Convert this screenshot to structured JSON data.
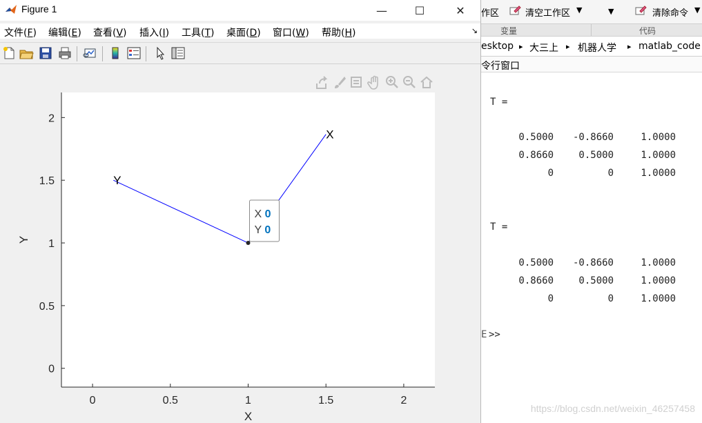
{
  "figure": {
    "title": "Figure 1",
    "window_controls": {
      "minimize": "—",
      "maximize": "☐",
      "close": "✕"
    },
    "menu": [
      {
        "label": "文件(",
        "key": "F",
        "end": ")"
      },
      {
        "label": "编辑(",
        "key": "E",
        "end": ")"
      },
      {
        "label": "查看(",
        "key": "V",
        "end": ")"
      },
      {
        "label": "插入(",
        "key": "I",
        "end": ")"
      },
      {
        "label": "工具(",
        "key": "T",
        "end": ")"
      },
      {
        "label": "桌面(",
        "key": "D",
        "end": ")"
      },
      {
        "label": "窗口(",
        "key": "W",
        "end": ")"
      },
      {
        "label": "帮助(",
        "key": "H",
        "end": ")"
      }
    ],
    "dock_arrow": "↘",
    "toolbar_icons": [
      "new-figure-icon",
      "open-file-icon",
      "save-icon",
      "print-icon",
      "link-plot-icon",
      "colorbar-icon",
      "legend-icon",
      "pointer-icon",
      "property-inspector-icon"
    ],
    "axes_toolbar_icons": [
      "export-icon",
      "brush-icon",
      "datatip-icon",
      "pan-icon",
      "zoom-in-icon",
      "zoom-out-icon",
      "home-icon"
    ],
    "colors": {
      "line": "#0000ff",
      "axes_bg": "#f0f0f0",
      "plot_bg": "#ffffff",
      "datatip_value": "#0072bd"
    }
  },
  "chart_data": {
    "type": "line",
    "xlabel": "X",
    "ylabel": "Y",
    "xlim": [
      -0.2,
      2.2
    ],
    "ylim": [
      -0.15,
      2.2
    ],
    "xticks": [
      0,
      0.5,
      1,
      1.5,
      2
    ],
    "xtick_labels": [
      "0",
      "0.5",
      "1",
      "1.5",
      "2"
    ],
    "yticks": [
      0,
      0.5,
      1,
      1.5,
      2
    ],
    "ytick_labels": [
      "0",
      "0.5",
      "1",
      "1.5",
      "2"
    ],
    "grid": false,
    "series": [
      {
        "x": [
          1,
          1.5
        ],
        "y": [
          1,
          1.866
        ],
        "color": "#0000ff"
      },
      {
        "x": [
          1,
          0.134
        ],
        "y": [
          1,
          1.5
        ],
        "color": "#0000ff"
      }
    ],
    "annotations": [
      {
        "text": "X",
        "x": 1.5,
        "y": 1.866
      },
      {
        "text": "Y",
        "x": 0.134,
        "y": 1.5
      }
    ],
    "origin_marker": {
      "x": 1,
      "y": 1
    },
    "datatip": {
      "x_label": "X",
      "x_value": "0",
      "y_label": "Y",
      "y_value": "0"
    }
  },
  "matlab": {
    "ribbon": {
      "clear_workspace_partial": "作区",
      "clear_workspace": "清空工作区",
      "clear_commands": "清除命令",
      "dropdown": "▼"
    },
    "sections": {
      "variable": "变量",
      "code": "代码"
    },
    "path": [
      "esktop",
      "大三上",
      "机器人学",
      "matlab_code"
    ],
    "path_sep": "▸",
    "command_window_title": "令行窗口",
    "outputs": [
      {
        "var": "T =",
        "rows": [
          [
            "0.5000",
            "-0.8660",
            "1.0000"
          ],
          [
            "0.8660",
            "0.5000",
            "1.0000"
          ],
          [
            "0",
            "0",
            "1.0000"
          ]
        ]
      },
      {
        "var": "T =",
        "rows": [
          [
            "0.5000",
            "-0.8660",
            "1.0000"
          ],
          [
            "0.8660",
            "0.5000",
            "1.0000"
          ],
          [
            "0",
            "0",
            "1.0000"
          ]
        ]
      }
    ],
    "prompt": ">>",
    "prompt_partial": "E",
    "watermark": "https://blog.csdn.net/weixin_46257458"
  }
}
